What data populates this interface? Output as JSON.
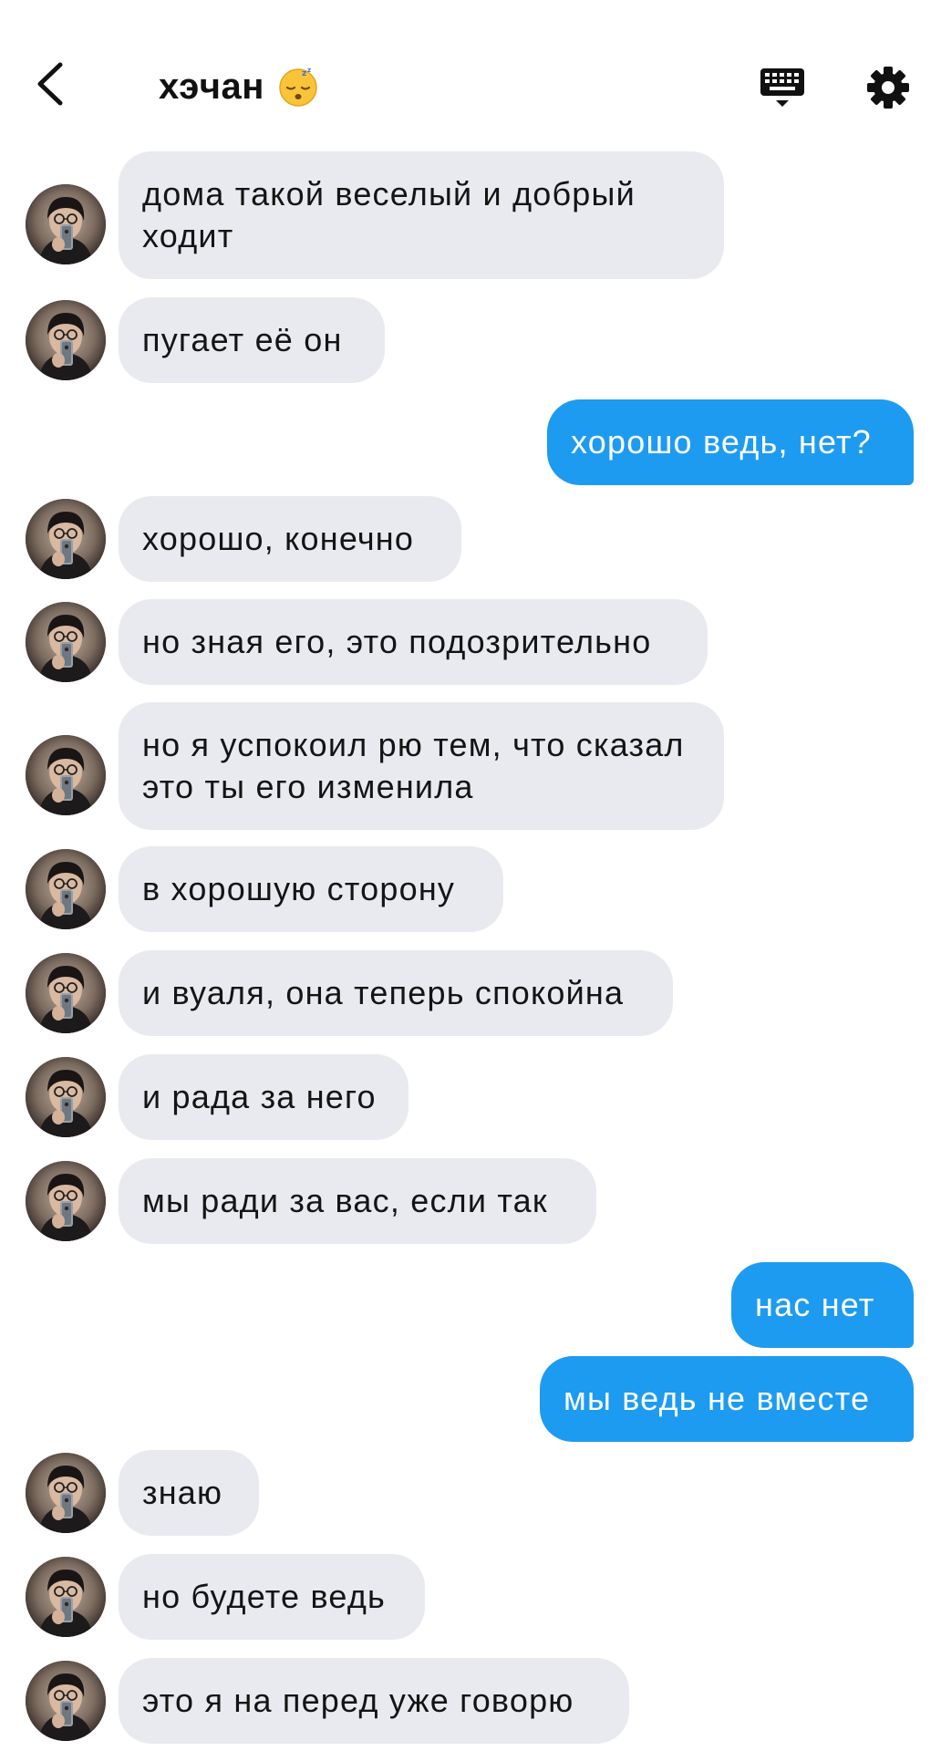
{
  "header": {
    "title": "хэчан",
    "title_icon": "sleeping-face-emoji",
    "back_icon": "chevron-left-icon",
    "keyboard_icon": "keyboard-icon",
    "settings_icon": "gear-icon"
  },
  "colors": {
    "incoming_bubble": "#e9eaf0",
    "outgoing_bubble": "#1d9bf0",
    "outgoing_text": "#ffffff"
  },
  "messages": [
    {
      "dir": "in",
      "text": "дома такой веселый и добрый ходит"
    },
    {
      "dir": "in",
      "text": "пугает её он"
    },
    {
      "dir": "out",
      "text": "хорошо ведь, нет?"
    },
    {
      "dir": "in",
      "text": "хорошо, конечно"
    },
    {
      "dir": "in",
      "text": "но зная его, это подозрительно"
    },
    {
      "dir": "in",
      "text": "но я успокоил рю тем, что сказал это ты его изменила"
    },
    {
      "dir": "in",
      "text": "в хорошую сторону"
    },
    {
      "dir": "in",
      "text": "и вуаля, она теперь спокойна"
    },
    {
      "dir": "in",
      "text": "и рада за него"
    },
    {
      "dir": "in",
      "text": "мы ради за вас, если так"
    },
    {
      "dir": "out",
      "text": "нас нет"
    },
    {
      "dir": "out",
      "text": "мы ведь не вместе"
    },
    {
      "dir": "in",
      "text": "знаю"
    },
    {
      "dir": "in",
      "text": "но будете ведь"
    },
    {
      "dir": "in",
      "text": "это я на перед уже говорю"
    }
  ]
}
